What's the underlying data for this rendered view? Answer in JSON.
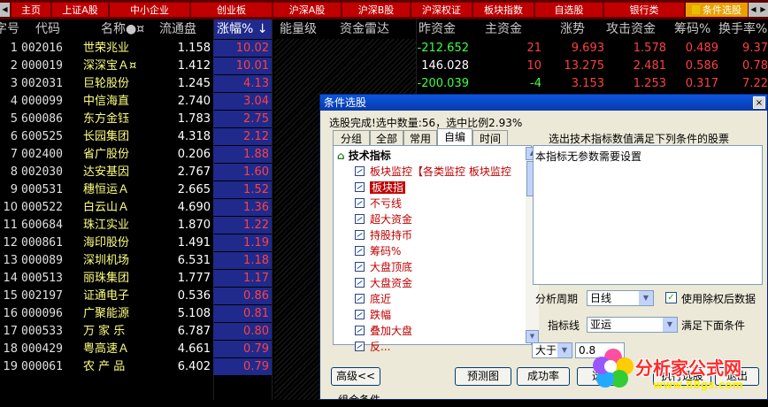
{
  "topTabs": [
    {
      "label": "主页"
    },
    {
      "label": "上证A股"
    },
    {
      "label": "中小企业"
    },
    {
      "label": "创业板"
    },
    {
      "label": "沪深A股"
    },
    {
      "label": "沪深B股"
    },
    {
      "label": "沪深权证"
    },
    {
      "label": "板块指数"
    },
    {
      "label": "自选股"
    },
    {
      "label": "银行类"
    },
    {
      "label": "条件选股"
    }
  ],
  "columns": [
    "字号",
    "代码",
    "名称●¤",
    "流通盘",
    "涨幅% ↓",
    "能量级",
    "资金雷达",
    "昨资金",
    "主资金",
    "涨势",
    "攻击资金",
    "筹码%",
    "换手率%"
  ],
  "rows": [
    {
      "n": "1",
      "code": "002016",
      "name": "世荣兆业",
      "ltp": "1.158",
      "pct": "10.02",
      "zzj": "-212.652",
      "zhu": "21",
      "zs": "9.693",
      "gj": "1.578",
      "cm": "0.489",
      "hs": "9.37"
    },
    {
      "n": "2",
      "code": "000019",
      "name": "深深宝Ａ¤",
      "ltp": "1.412",
      "pct": "10.01",
      "zzj": "146.028",
      "zhu": "10",
      "zs": "13.275",
      "gj": "2.481",
      "cm": "0.586",
      "hs": "0.78"
    },
    {
      "n": "3",
      "code": "002031",
      "name": "巨轮股份",
      "ltp": "1.245",
      "pct": "4.13",
      "zzj": "-200.039",
      "zhu": "-4",
      "zs": "3.153",
      "gj": "1.253",
      "cm": "0.317",
      "hs": "7.22"
    },
    {
      "n": "4",
      "code": "000099",
      "name": "中信海直",
      "ltp": "2.740",
      "pct": "3.04"
    },
    {
      "n": "5",
      "code": "600086",
      "name": "东方金钰",
      "ltp": "1.783",
      "pct": "2.75"
    },
    {
      "n": "6",
      "code": "600525",
      "name": "长园集团",
      "ltp": "4.318",
      "pct": "2.12"
    },
    {
      "n": "7",
      "code": "002400",
      "name": "省广股份",
      "ltp": "0.206",
      "pct": "1.88"
    },
    {
      "n": "8",
      "code": "002030",
      "name": "达安基因",
      "ltp": "2.767",
      "pct": "1.60"
    },
    {
      "n": "9",
      "code": "000531",
      "name": "穗恒运Ａ",
      "ltp": "2.665",
      "pct": "1.52"
    },
    {
      "n": "10",
      "code": "000522",
      "name": "白云山Ａ",
      "ltp": "4.690",
      "pct": "1.36"
    },
    {
      "n": "11",
      "code": "600684",
      "name": "珠江实业",
      "ltp": "1.870",
      "pct": "1.22"
    },
    {
      "n": "12",
      "code": "000861",
      "name": "海印股份",
      "ltp": "1.491",
      "pct": "1.19"
    },
    {
      "n": "13",
      "code": "000089",
      "name": "深圳机场",
      "ltp": "6.531",
      "pct": "1.18"
    },
    {
      "n": "14",
      "code": "000513",
      "name": "丽珠集团",
      "ltp": "1.777",
      "pct": "1.17"
    },
    {
      "n": "15",
      "code": "002197",
      "name": "证通电子",
      "ltp": "0.536",
      "pct": "0.86"
    },
    {
      "n": "16",
      "code": "000096",
      "name": "广聚能源",
      "ltp": "5.108",
      "pct": "0.81"
    },
    {
      "n": "17",
      "code": "000533",
      "name": "万 家 乐",
      "ltp": "6.787",
      "pct": "0.80"
    },
    {
      "n": "18",
      "code": "000429",
      "name": "粤高速Ａ",
      "ltp": "4.661",
      "pct": "0.79"
    },
    {
      "n": "19",
      "code": "000061",
      "name": "农 产 品",
      "ltp": "6.402",
      "pct": "0.79"
    }
  ],
  "dialog": {
    "title": "条件选股",
    "close": "×",
    "status": "选股完成!选中数量:56，选中比例2.93%",
    "tabs": [
      "分组",
      "全部",
      "常用",
      "自编",
      "时间"
    ],
    "treeRoot": "技术指标",
    "items": [
      "板块监控【各类监控 板块监控",
      "板块指",
      "不亏线",
      "超大资金",
      "持股持币",
      "筹码%",
      "大盘顶底",
      "大盘资金",
      "底近",
      "跌幅",
      "叠加大盘",
      "反..."
    ],
    "descHeader": "选出技术指标数值满足下列条件的股票",
    "desc": "本指标无参数需要设置",
    "periodLabel": "分析周期",
    "period": "日线",
    "adjustLabel": "使用除权后数据",
    "indLabel": "指标线",
    "ind": "亚运",
    "condLabel": "满足下面条件",
    "op": "大于",
    "val": "0.8",
    "btnAdvanced": "高级<<",
    "btnPreview": "预测图",
    "btnRate": "成功率",
    "btnSel": "选",
    "btnExec": "执行选股",
    "btnExit": "退出",
    "groupLabel": "组合条件"
  },
  "logo": {
    "main": "分析家公式网",
    "sub": "www.88gs.com"
  },
  "colors": {
    "accent": "#c00000",
    "sortedBg": "#1f2a8c",
    "activeTab": "#e8a000"
  }
}
